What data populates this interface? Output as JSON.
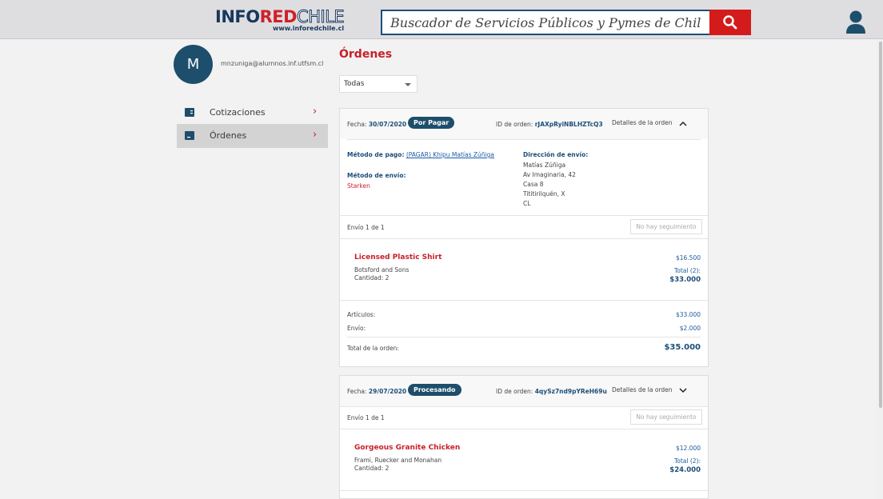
{
  "header": {
    "logo": {
      "info": "INFO",
      "red": "RED",
      "chile": "CHILE",
      "sub": "www.inforedchile.cl"
    },
    "search_placeholder": "Buscador de Servicios Públicos y Pymes de Chile..."
  },
  "user": {
    "initial": "M",
    "email": "mnzuniga@alumnos.inf.utfsm.cl"
  },
  "sidebar": {
    "items": [
      {
        "label": "Cotizaciones",
        "chevron": "›"
      },
      {
        "label": "Órdenes",
        "chevron": "›"
      }
    ]
  },
  "main": {
    "title": "Órdenes",
    "filter": "Todas",
    "orders": [
      {
        "fecha_label": "Fecha:",
        "fecha": "30/07/2020",
        "status": "Por Pagar",
        "id_label": "ID de orden:",
        "id": "rJAXpRyiNBLHZTcQ3",
        "details_label": "Detalles de la orden",
        "payment_label": "Método de pago:",
        "payment_value": "(PAGAR) Khipu Matías Zúñiga",
        "shipping_method_label": "Método de envío:",
        "shipping_method": "Starken",
        "address_label": "Dirección de envío:",
        "address_lines": [
          "Matías Zúñiga",
          "Av Imaginaria, 42",
          "Casa 8",
          "Tititirilquén, X",
          "CL"
        ],
        "shipment_label": "Envío 1 de 1",
        "tracking": "No hay seguimiento",
        "product": {
          "name": "Licensed Plastic Shirt",
          "vendor": "Botsford and Sons",
          "quantity": "Cantidad: 2",
          "unit_price": "$16.500",
          "total_label": "Total (2):",
          "total": "$33.000"
        },
        "summary": {
          "articles_label": "Artículos:",
          "articles": "$33.000",
          "shipping_label": "Envío:",
          "shipping": "$2.000",
          "order_total_label": "Total de la orden:",
          "order_total": "$35.000"
        }
      },
      {
        "fecha_label": "Fecha:",
        "fecha": "29/07/2020",
        "status": "Procesando",
        "id_label": "ID de orden:",
        "id": "4qySz7nd9pYReH69u",
        "details_label": "Detalles de la orden",
        "shipment_label": "Envío 1 de 1",
        "tracking": "No hay seguimiento",
        "product": {
          "name": "Gorgeous Granite Chicken",
          "vendor": "Frami, Ruecker and Monahan",
          "quantity": "Cantidad: 2",
          "unit_price": "$12.000",
          "total_label": "Total (2):",
          "total": "$24.000"
        }
      }
    ]
  }
}
